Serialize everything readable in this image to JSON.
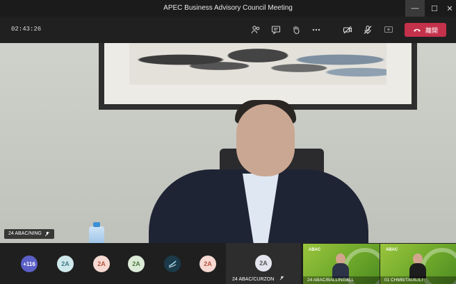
{
  "window": {
    "title": "APEC Business Advisory Council Meeting"
  },
  "toolbar": {
    "timer": "02:43:26",
    "leave_label": "離開"
  },
  "main_video": {
    "name_label": "24 ABAC/NING"
  },
  "participants": {
    "overflow_count": "+116",
    "avatars": [
      "2A",
      "2A",
      "2A",
      "2A",
      "2A"
    ],
    "active": {
      "initials": "2A",
      "name": "24 ABAC/CURZON"
    },
    "video_tiles": [
      {
        "name": "24 ABAC/BALLINGALL"
      },
      {
        "name": "01 CHMB/TAUILILI"
      }
    ],
    "tile_logo_text": "ABAC"
  },
  "colors": {
    "leave": "#c4314b",
    "accent": "#5b5fc7",
    "tile_green": "#6ea82b"
  }
}
